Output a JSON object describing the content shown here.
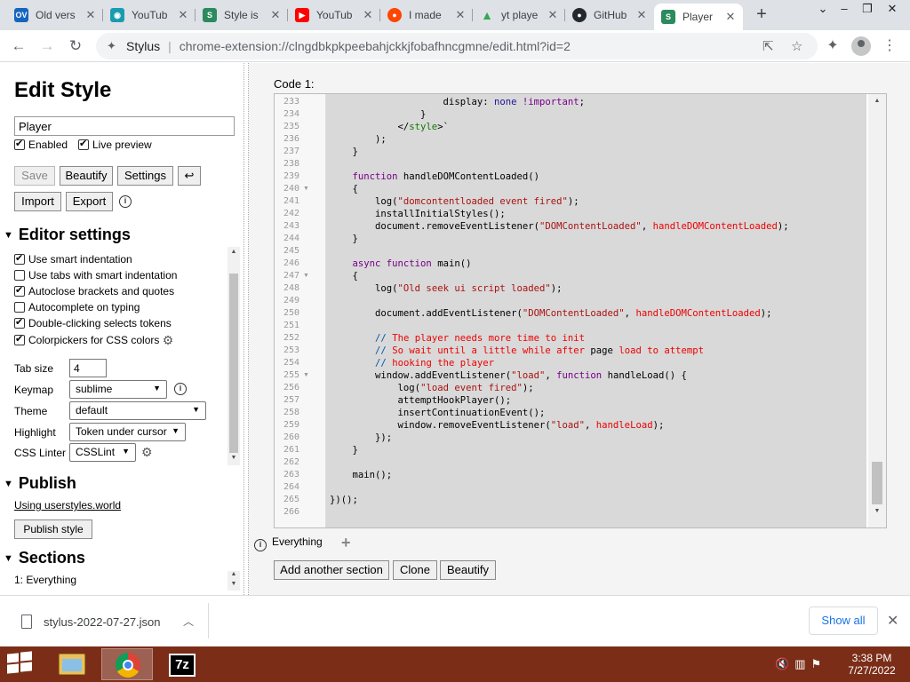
{
  "browser": {
    "tabs": [
      {
        "label": "Old vers",
        "favicon": "OV",
        "color": "#1565c0"
      },
      {
        "label": "YouTub",
        "favicon": "YT",
        "color": "#1a9cb0"
      },
      {
        "label": "Style is",
        "favicon": "S",
        "color": "#2b8a5e"
      },
      {
        "label": "YouTub",
        "favicon": "▶",
        "color": "#ff0000"
      },
      {
        "label": "I made",
        "favicon": "r",
        "color": "#ff4500"
      },
      {
        "label": "yt playe",
        "favicon": "▲",
        "color": "#34a853"
      },
      {
        "label": "GitHub",
        "favicon": "●",
        "color": "#24292f"
      },
      {
        "label": "Player",
        "favicon": "S",
        "color": "#2b8a5e"
      }
    ],
    "new_tab_symbol": "+",
    "extension_name": "Stylus",
    "url": "chrome-extension://clngdbkpkpeebahjckkjfobafhncgmne/edit.html?id=2",
    "window_buttons": [
      "⌄",
      "–",
      "❐",
      "✕"
    ]
  },
  "editor_page": {
    "title": "Edit Style",
    "style_name": "Player",
    "enabled_label": "Enabled",
    "live_preview_label": "Live preview",
    "buttons": {
      "save": "Save",
      "beautify": "Beautify",
      "settings": "Settings",
      "undo": "↩",
      "import": "Import",
      "export": "Export"
    },
    "editor_settings": {
      "heading": "Editor settings",
      "options": [
        {
          "label": "Use smart indentation",
          "checked": true
        },
        {
          "label": "Use tabs with smart indentation",
          "checked": false
        },
        {
          "label": "Autoclose brackets and quotes",
          "checked": true
        },
        {
          "label": "Autocomplete on typing",
          "checked": false
        },
        {
          "label": "Double-clicking selects tokens",
          "checked": true
        },
        {
          "label": "Colorpickers for CSS colors",
          "checked": true
        }
      ],
      "tab_size_label": "Tab size",
      "tab_size_value": "4",
      "keymap_label": "Keymap",
      "keymap_value": "sublime",
      "theme_label": "Theme",
      "theme_value": "default",
      "highlight_label": "Highlight",
      "highlight_value": "Token under cursor",
      "linter_label": "CSS Linter",
      "linter_value": "CSSLint"
    },
    "publish": {
      "heading": "Publish",
      "link": "Using userstyles.world",
      "button": "Publish style"
    },
    "sections": {
      "heading": "Sections",
      "item": "1: Everything"
    }
  },
  "code": {
    "label": "Code 1:",
    "section_applies": "Everything",
    "buttons": {
      "add_section": "Add another section",
      "clone": "Clone",
      "beautify": "Beautify"
    }
  },
  "downloads": {
    "filename": "stylus-2022-07-27.json",
    "show_all": "Show all"
  },
  "taskbar": {
    "time": "3:38 PM",
    "date": "7/27/2022",
    "apps": [
      "file-explorer",
      "chrome",
      "7-zip"
    ]
  }
}
